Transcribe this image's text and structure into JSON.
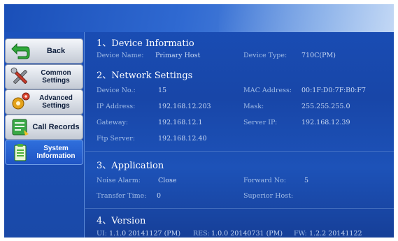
{
  "colors": {
    "screen_bg": "#1a4fb8",
    "sidebar_active": "#2f6fdc",
    "button_face": "#e4e8ee",
    "label_text": "#9fbbe6",
    "title_text": "#ffffff"
  },
  "sidebar": {
    "items": [
      {
        "label_lines": [
          "Back"
        ],
        "icon": "back-arrow-icon",
        "active": false
      },
      {
        "label_lines": [
          "Common",
          "Settings"
        ],
        "icon": "tools-icon",
        "active": false
      },
      {
        "label_lines": [
          "Advanced",
          "Settings"
        ],
        "icon": "gears-icon",
        "active": false
      },
      {
        "label_lines": [
          "Call Records"
        ],
        "icon": "call-records-icon",
        "active": false
      },
      {
        "label_lines": [
          "System",
          "Information"
        ],
        "icon": "info-document-icon",
        "active": true
      }
    ]
  },
  "sections": {
    "device": {
      "title": "1、Device Informatio",
      "name_label": "Device Name:",
      "name_value": "Primary Host",
      "type_label": "Device Type:",
      "type_value": "710C(PM)"
    },
    "network": {
      "title": "2、Network Settings",
      "device_no_label": "Device No.:",
      "device_no_value": "15",
      "mac_label": "MAC Address:",
      "mac_value": "00:1F:D0:7F:B0:F7",
      "ip_label": "IP Address:",
      "ip_value": "192.168.12.203",
      "mask_label": "Mask:",
      "mask_value": "255.255.255.0",
      "gateway_label": "Gateway:",
      "gateway_value": "192.168.12.1",
      "server_ip_label": "Server IP:",
      "server_ip_value": "192.168.12.39",
      "ftp_label": "Ftp Server:",
      "ftp_value": "192.168.12.40"
    },
    "application": {
      "title": "3、Application",
      "noise_label": "Noise Alarm:",
      "noise_value": "Close",
      "forward_label": "Forward No:",
      "forward_value": "5",
      "transfer_label": "Transfer Time:",
      "transfer_value": "0",
      "superior_label": "Superior Host:",
      "superior_value": ""
    },
    "version": {
      "title": "4、Version",
      "ui_label": "UI:",
      "ui_value": "1.1.0 20141127 (PM)",
      "res_label": "RES:",
      "res_value": "1.0.0 20140731 (PM)",
      "fw_label": "FW:",
      "fw_value": "1.2.2 20141122"
    }
  }
}
